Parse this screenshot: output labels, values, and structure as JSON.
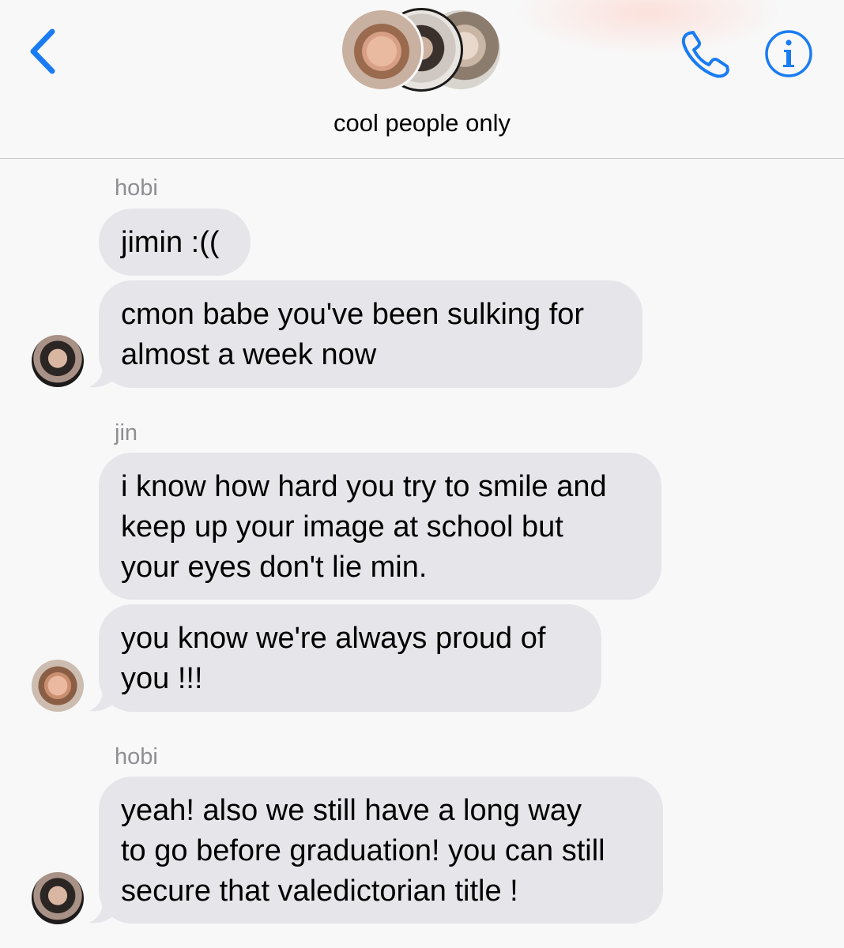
{
  "header": {
    "group_name": "cool people only",
    "back_icon": "chevron-left-icon",
    "call_icon": "phone-icon",
    "info_icon": "info-icon",
    "accent_color": "#1a7cf2"
  },
  "messages": [
    {
      "sender": "hobi",
      "lines": [
        "jimin :(("
      ]
    },
    {
      "lines": [
        "cmon babe you've been sulking for",
        "almost a week now"
      ]
    },
    {
      "sender": "jin",
      "lines": [
        "i know how hard you try to smile and",
        "keep up your image at school but",
        "your eyes don't lie min."
      ]
    },
    {
      "lines": [
        "you know we're always proud of",
        "you !!!"
      ]
    },
    {
      "sender": "hobi",
      "lines": [
        "yeah! also we still have a long way",
        "to go before graduation! you can still",
        "secure that valedictorian title !"
      ]
    }
  ],
  "colors": {
    "bubble": "#e5e5ea",
    "sender_label": "#8e8e93",
    "background": "#f8f8f8"
  }
}
